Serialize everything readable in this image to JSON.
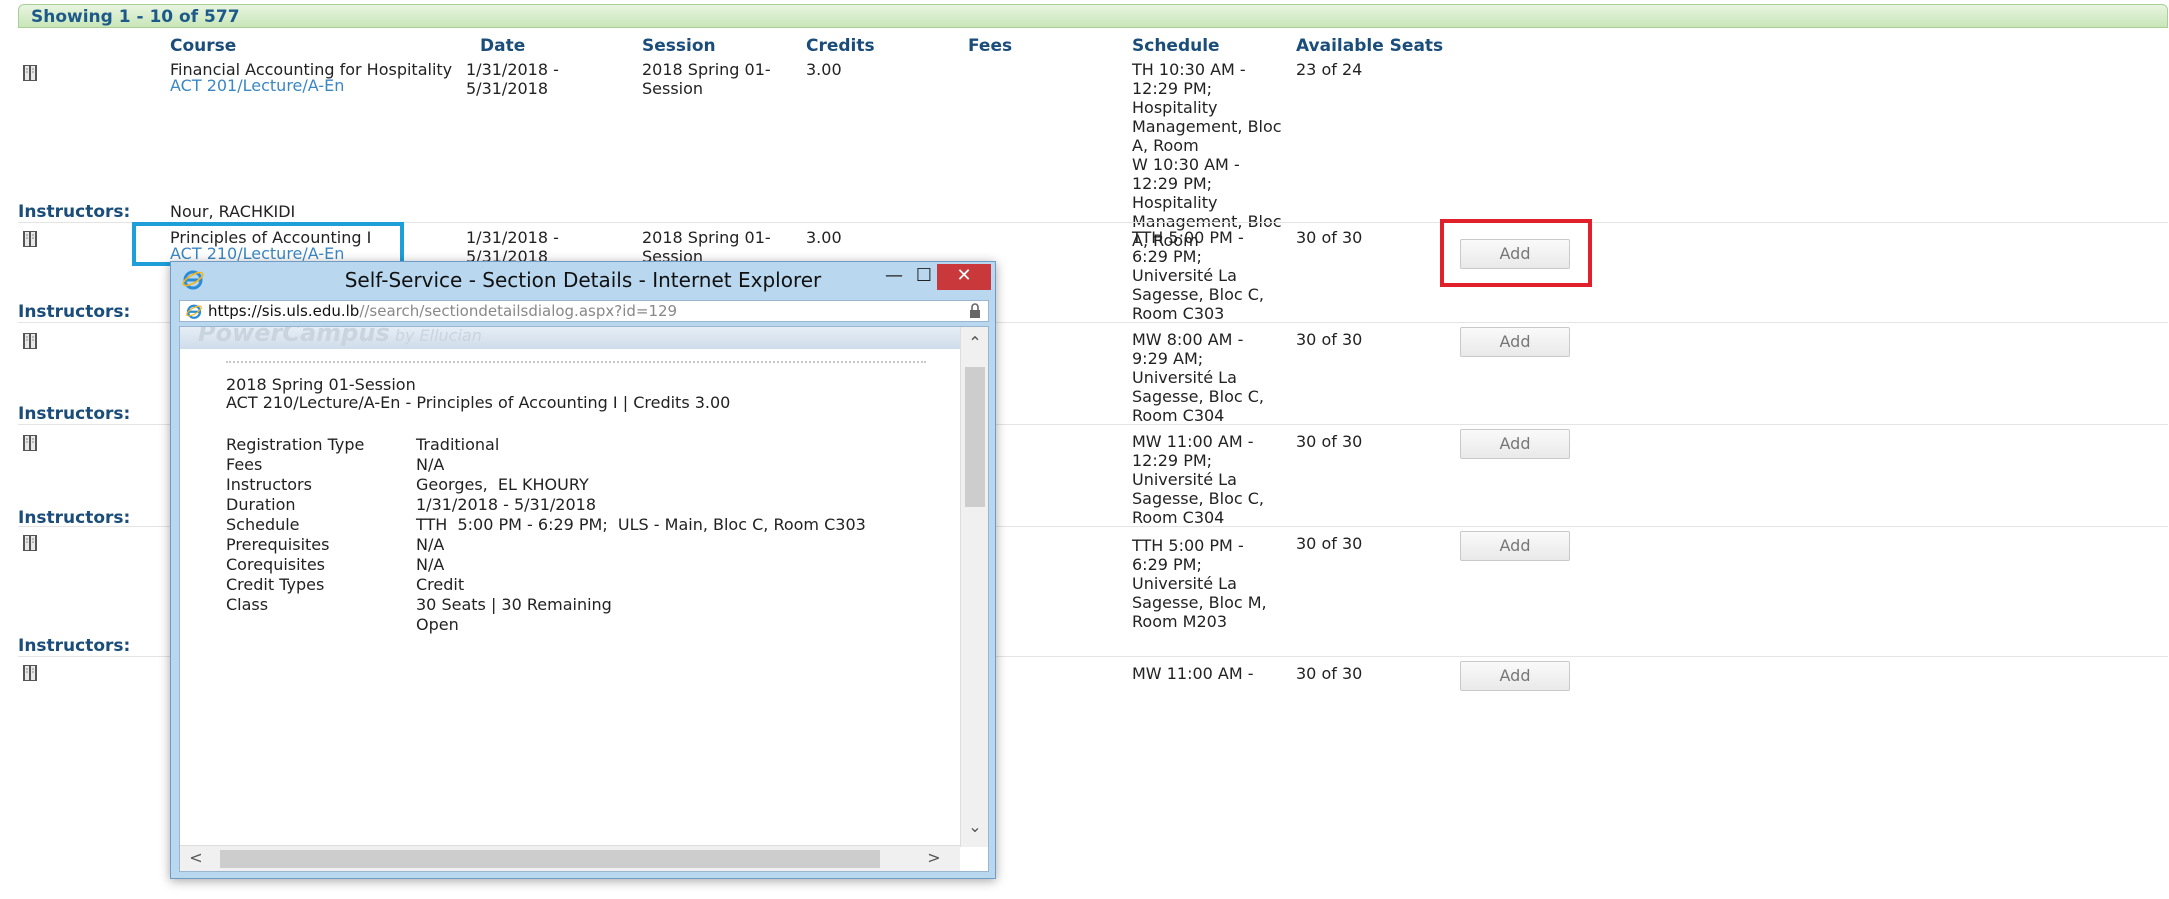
{
  "banner": "Showing 1 - 10 of 577",
  "headers": {
    "course": "Course",
    "date": "Date",
    "session": "Session",
    "credits": "Credits",
    "fees": "Fees",
    "schedule": "Schedule",
    "seats": "Available Seats"
  },
  "instructors_label": "Instructors:",
  "add_label": "Add",
  "rows": [
    {
      "title": "Financial Accounting for Hospitality",
      "code": "ACT 201/Lecture/A-En",
      "date": "1/31/2018 -\n5/31/2018",
      "session": "2018 Spring 01-\nSession",
      "credits": "3.00",
      "schedule": "TH 10:30 AM -\n12:29 PM;\nHospitality\nManagement, Bloc\nA, Room\nW 10:30 AM -\n12:29 PM;\nHospitality\nManagement, Bloc\nA, Room",
      "seats": "23 of 24",
      "instructor": "Nour, RACHKIDI"
    },
    {
      "title": "Principles of Accounting I",
      "code": "ACT 210/Lecture/A-En",
      "date": "1/31/2018 -\n5/31/2018",
      "session": "2018 Spring 01-\nSession",
      "credits": "3.00",
      "schedule": "TTH 5:00 PM -\n6:29 PM;\nUniversité La\nSagesse, Bloc C,\nRoom C303",
      "seats": "30 of 30"
    },
    {
      "schedule": "MW 8:00 AM -\n9:29 AM;\nUniversité La\nSagesse, Bloc C,\nRoom C304",
      "seats": "30 of 30"
    },
    {
      "schedule": "MW 11:00 AM -\n12:29 PM;\nUniversité La\nSagesse, Bloc C,\nRoom C304",
      "seats": "30 of 30"
    },
    {
      "schedule": "TTH 5:00 PM -\n6:29 PM;\nUniversité La\nSagesse, Bloc M,\nRoom M203",
      "seats": "30 of 30"
    },
    {
      "schedule": "MW 11:00 AM -",
      "seats": "30 of 30"
    }
  ],
  "popup": {
    "title": "Self-Service - Section Details - Internet Explorer",
    "url_prefix": "https://sis.",
    "url_domain": "uls.edu.lb",
    "url_rest": "//search/sectiondetailsdialog.aspx?id=129",
    "brand": "PowerCampus",
    "brand_by": " by Ellucian",
    "session": "2018 Spring 01-Session",
    "heading": "ACT 210/Lecture/A-En - Principles of Accounting I | Credits 3.00",
    "details": [
      {
        "label": "Registration Type",
        "value": "Traditional"
      },
      {
        "label": "Fees",
        "value": "N/A"
      },
      {
        "label": "Instructors",
        "value": "Georges,  EL KHOURY"
      },
      {
        "label": "Duration",
        "value": "1/31/2018 - 5/31/2018"
      },
      {
        "label": "Schedule",
        "value": "TTH  5:00 PM - 6:29 PM;  ULS - Main, Bloc C, Room C303"
      },
      {
        "label": "Prerequisites",
        "value": "N/A"
      },
      {
        "label": "Corequisites",
        "value": "N/A"
      },
      {
        "label": "Credit Types",
        "value": "Credit"
      },
      {
        "label": "Class",
        "value": "30 Seats | 30 Remaining"
      },
      {
        "label": "",
        "value": "Open"
      }
    ]
  },
  "colors": {
    "link": "#3a87c4",
    "header": "#1a4d7a",
    "highlight_blue": "#1e9fd9",
    "highlight_red": "#e0202a"
  }
}
